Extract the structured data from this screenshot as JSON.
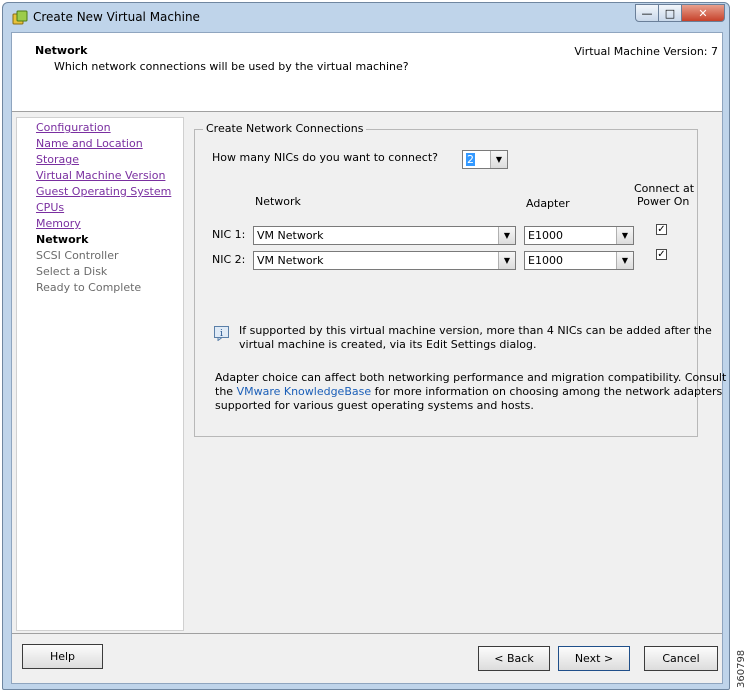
{
  "window": {
    "title": "Create New Virtual Machine"
  },
  "header": {
    "title": "Network",
    "subtitle": "Which network connections will be used by the virtual machine?",
    "version": "Virtual Machine Version: 7"
  },
  "nav": {
    "items": [
      {
        "label": "Configuration",
        "state": "link"
      },
      {
        "label": "Name and Location",
        "state": "link"
      },
      {
        "label": "Storage",
        "state": "link"
      },
      {
        "label": "Virtual Machine Version",
        "state": "link"
      },
      {
        "label": "Guest Operating System",
        "state": "link"
      },
      {
        "label": "CPUs",
        "state": "link"
      },
      {
        "label": "Memory",
        "state": "link"
      },
      {
        "label": "Network",
        "state": "current"
      },
      {
        "label": "SCSI Controller",
        "state": "future"
      },
      {
        "label": "Select a Disk",
        "state": "future"
      },
      {
        "label": "Ready to Complete",
        "state": "future"
      }
    ]
  },
  "content": {
    "group_title": "Create Network Connections",
    "nic_count_question": "How many NICs do you want to connect?",
    "nic_count_value": "2",
    "columns": {
      "network": "Network",
      "adapter": "Adapter",
      "connect_line1": "Connect at",
      "connect_line2": "Power On"
    },
    "nics": [
      {
        "label": "NIC 1:",
        "network": "VM Network",
        "adapter": "E1000",
        "connect": true
      },
      {
        "label": "NIC 2:",
        "network": "VM Network",
        "adapter": "E1000",
        "connect": true
      }
    ],
    "info_line1": "If supported by this virtual machine version, more than 4 NICs can be added after the",
    "info_line2": "virtual machine is created, via its Edit Settings dialog.",
    "adapter_line1": "Adapter choice can affect both networking performance and migration compatibility. Consult",
    "adapter_line2_pre": "the ",
    "adapter_link": "VMware KnowledgeBase",
    "adapter_line2_post": " for more information on choosing among the network adapters",
    "adapter_line3": "supported for various guest operating systems and hosts."
  },
  "footer": {
    "help": "Help",
    "back": "< Back",
    "next": "Next >",
    "cancel": "Cancel"
  },
  "watermark": "360798",
  "colors": {
    "link_visited": "#7a2fa0",
    "link": "#1b5fb8",
    "selection": "#3399ff"
  },
  "icons": {
    "app": "vm-wizard-icon",
    "info": "info-icon",
    "dropdown": "chevron-down-icon"
  }
}
